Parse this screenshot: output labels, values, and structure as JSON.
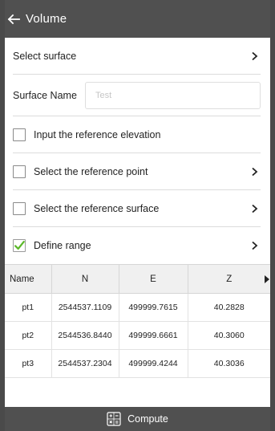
{
  "header": {
    "title": "Volume",
    "back_icon": "arrow-left-icon"
  },
  "select_surface": {
    "label": "Select surface",
    "icon": "chevron-right-icon"
  },
  "surface_name": {
    "label": "Surface Name",
    "value": "",
    "placeholder": "Test"
  },
  "options": [
    {
      "label": "Input the reference elevation",
      "checked": false,
      "has_chevron": false
    },
    {
      "label": "Select the reference point",
      "checked": false,
      "has_chevron": true
    },
    {
      "label": "Select the reference surface",
      "checked": false,
      "has_chevron": true
    },
    {
      "label": "Define range",
      "checked": true,
      "has_chevron": true
    }
  ],
  "table": {
    "columns": [
      "Name",
      "N",
      "E",
      "Z"
    ],
    "rows": [
      [
        "pt1",
        "2544537.1109",
        "499999.7615",
        "40.2828"
      ],
      [
        "pt2",
        "2544536.8440",
        "499999.6661",
        "40.3060"
      ],
      [
        "pt3",
        "2544537.2304",
        "499999.4244",
        "40.3036"
      ]
    ]
  },
  "footer": {
    "label": "Compute",
    "icon": "calculator-icon"
  },
  "colors": {
    "header_bg": "#505050",
    "footer_bg": "#505050",
    "check_green": "#5cb82a",
    "table_header_bg": "#f0f0f0"
  }
}
